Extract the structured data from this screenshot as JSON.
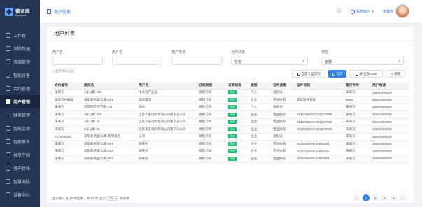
{
  "app": {
    "logo_name": "德派园",
    "logo_sub": "Dipaiyuan"
  },
  "sidebar": {
    "items": [
      {
        "label": "工作台",
        "icon": "desk-icon",
        "active": false
      },
      {
        "label": "消防数据",
        "icon": "fire-icon",
        "active": false
      },
      {
        "label": "资源管理",
        "icon": "resource-icon",
        "active": false
      },
      {
        "label": "智能设备",
        "icon": "device-icon",
        "active": false
      },
      {
        "label": "合约管理",
        "icon": "contract-icon",
        "active": false
      },
      {
        "label": "用户管理",
        "icon": "user-icon",
        "active": true
      },
      {
        "label": "财务管理",
        "icon": "finance-icon",
        "active": false
      },
      {
        "label": "智能监测",
        "icon": "monitor-icon",
        "active": false
      },
      {
        "label": "智能事件",
        "icon": "event-icon",
        "active": false
      },
      {
        "label": "共享空间",
        "icon": "share-icon",
        "active": false
      },
      {
        "label": "资产台帐",
        "icon": "asset-icon",
        "active": false
      },
      {
        "label": "智慧消防",
        "icon": "smart-fire-icon",
        "active": false
      },
      {
        "label": "设备中心",
        "icon": "center-icon",
        "active": false
      }
    ]
  },
  "header": {
    "tab": "用户信息",
    "selected_user": "系统用户",
    "username": "张保安"
  },
  "main": {
    "title": "用户列表",
    "filters": [
      {
        "label": "用户名",
        "value": ""
      },
      {
        "label": "用户名",
        "value": ""
      },
      {
        "label": "用户电话",
        "value": ""
      },
      {
        "label": "合约状态",
        "value": "在租"
      },
      {
        "label": "排名",
        "value": "全部"
      }
    ],
    "advanced": "显示高级过滤",
    "buttons": {
      "custom_cols": "自定义显示列",
      "print": "打印",
      "export": "导出到Excel",
      "refresh": "刷新"
    }
  },
  "table": {
    "headers": [
      "合约编号",
      "房间名",
      "用户名",
      "订阅类型",
      "订阅状态",
      "类型",
      "证件类型",
      "证件号码",
      "银行卡号",
      "用户电话"
    ],
    "rows": [
      [
        "未填写",
        "2号公寓-105",
        "中关村产业园",
        "视频订阅",
        "开启",
        "个人",
        "身份证",
        "",
        "未填写",
        "18800000000"
      ],
      [
        "测试合约编号",
        "深圳新格里/公寓-201",
        "测试集团",
        "视频订阅",
        "开启",
        "企业",
        "营业执照",
        "测试证件号码",
        "8888",
        "18800000000"
      ],
      [
        "未填写",
        "智慧园区同学楼-101",
        "测试",
        "视频订阅",
        "开启",
        "个人",
        "身份证",
        "",
        "未填写",
        "18800000000"
      ],
      [
        "未填写",
        "2号公寓-201",
        "江苏华安电机有限公司南京分公司",
        "视频订阅",
        "开启",
        "企业",
        "营业执照",
        "91320184MA1GQG7D58",
        "未填写",
        "16681496000"
      ],
      [
        "未填写",
        "2号公寓-18",
        "江苏华安电机有限公司南京分公司",
        "视频订阅",
        "开启",
        "企业",
        "营业执照",
        "91320184MA1GQG7D58",
        "未填写",
        "16681496000"
      ],
      [
        "未填写",
        "2号公寓-19",
        "江苏华安电机有限公司南京分公司",
        "视频订阅",
        "开启",
        "企业",
        "营业执照",
        "91320184MA1GQG7D58",
        "未填写",
        "16681496000"
      ],
      [
        "CY0000000",
        "深圳新格里/公寓-新增报告",
        "公司",
        "视频订阅",
        "开启",
        "企业",
        "身份证",
        "",
        "未填写",
        "15800000000"
      ],
      [
        "未填写",
        "深圳新格里/公寓-601",
        "周晓亮",
        "视频订阅",
        "开启",
        "企业",
        "营业执照",
        "91320184MA34881021",
        "未填写",
        "15800000000"
      ],
      [
        "未填写",
        "深圳新格里/公寓-603",
        "周晓亮",
        "视频订阅",
        "开启",
        "企业",
        "营业执照",
        "91320184MA34881021",
        "未填写",
        "15800000000"
      ],
      [
        "未填写",
        "深圳新格里/公寓-602",
        "周晓亮",
        "视频订阅",
        "开启",
        "企业",
        "营业执照",
        "91320184MA34881021",
        "未填写",
        "15800000000"
      ]
    ]
  },
  "pagination": {
    "info_prefix": "显示第 1 至 10 项结果，共 33 项",
    "page_size_label": "显示",
    "page_size": "10",
    "page_size_suffix": "项结果",
    "pages": [
      "‹",
      "1",
      "2",
      "3",
      "4",
      "›"
    ],
    "current": "1"
  },
  "colors": {
    "sidebar": "#243453",
    "accent": "#2f80ed",
    "tag": "#19be6b"
  }
}
